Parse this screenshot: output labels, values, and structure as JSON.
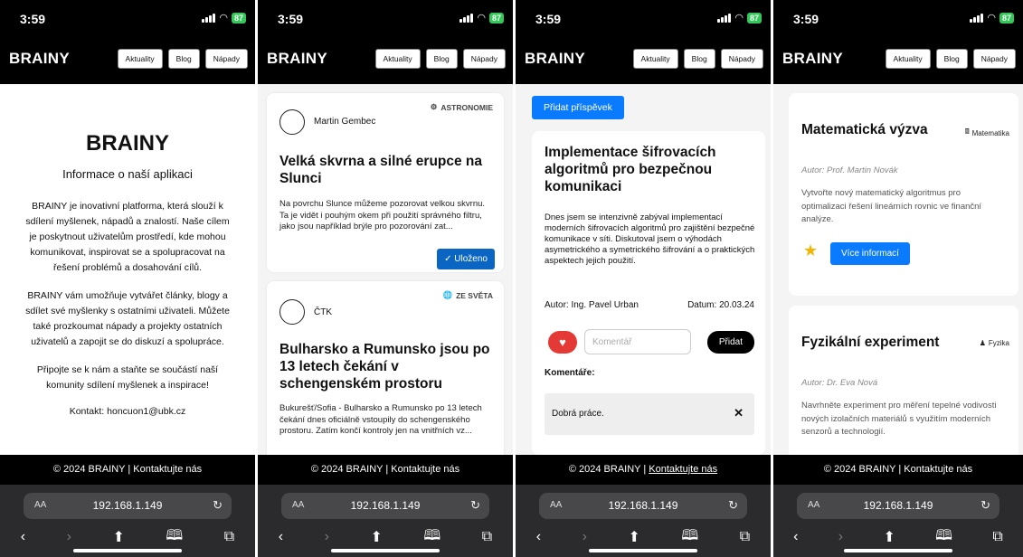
{
  "status": {
    "time": "3:59",
    "battery": "87"
  },
  "app": {
    "brand": "BRAINY",
    "nav": [
      "Aktuality",
      "Blog",
      "Nápady"
    ]
  },
  "footer": {
    "text": "© 2024 BRAINY | ",
    "link": "Kontaktujte nás"
  },
  "browser": {
    "aa": "AA",
    "url": "192.168.1.149"
  },
  "about": {
    "title": "BRAINY",
    "subtitle": "Informace o naší aplikaci",
    "paragraphs": [
      "BRAINY je inovativní platforma, která slouží k sdílení myšlenek, nápadů a znalostí. Naše cílem je poskytnout uživatelům prostředí, kde mohou komunikovat, inspirovat se a spolupracovat na řešení problémů a dosahování cílů.",
      "BRAINY vám umožňuje vytvářet články, blogy a sdílet své myšlenky s ostatními uživateli. Můžete také prozkoumat nápady a projekty ostatních uživatelů a zapojit se do diskuzí a spolupráce.",
      "Připojte se k nám a staňte se součástí naší komunity sdílení myšlenek a inspirace!"
    ],
    "contact": "Kontakt: honcuon1@ubk.cz"
  },
  "news": [
    {
      "author": "Martin Gembec",
      "category": "ASTRONOMIE",
      "title": "Velká skvrna a silné erupce na Slunci",
      "excerpt": "Na povrchu Slunce můžeme pozorovat velkou skvrnu. Ta je vidět i pouhým okem při použití správného filtru, jako jsou například brýle pro pozorování zat...",
      "button": "✓ Uloženo"
    },
    {
      "author": "ČTK",
      "category": "ZE SVĚTA",
      "title": "Bulharsko a Rumunsko jsou po 13 letech čekání v schengenském prostoru",
      "excerpt": "Bukurešť/Sofia - Bulharsko a Rumunsko po 13 letech čekání dnes oficiálně vstoupily do schengenského prostoru. Zatím končí kontroly jen na vnitřních vz..."
    }
  ],
  "blog": {
    "add_button": "Přidat příspěvek",
    "post": {
      "title": "Implementace šifrovacích algoritmů pro bezpečnou komunikaci",
      "body": "Dnes jsem se intenzivně zabýval implementací moderních šifrovacích algoritmů pro zajištění bezpečné komunikace v síti. Diskutoval jsem o výhodách asymetrického a symetrického šifrování a o praktických aspektech jejich použití.",
      "author": "Autor: Ing. Pavel Urban",
      "date": "Datum: 20.03.24",
      "comment_placeholder": "Komentář",
      "add_comment": "Přidat",
      "comments_label": "Komentáře:",
      "comments": [
        "Dobrá práce."
      ]
    }
  },
  "ideas": [
    {
      "title": "Matematická výzva",
      "tag": "Matematika",
      "author": "Autor: Prof. Martin Novák",
      "description": "Vytvořte nový matematický algoritmus pro optimalizaci řešení lineárních rovnic ve finanční analýze.",
      "button": "Více informací"
    },
    {
      "title": "Fyzikální experiment",
      "tag": "Fyzika",
      "author": "Autor: Dr. Eva Nová",
      "description": "Navrhněte experiment pro měření tepelné vodivosti nových izolačních materiálů s využitím moderních senzorů a technologií."
    }
  ],
  "colors": {
    "primary": "#0a7bff",
    "saved": "#0a66c2",
    "heart": "#e53935",
    "star": "#f5b400",
    "bar": "#000000"
  }
}
